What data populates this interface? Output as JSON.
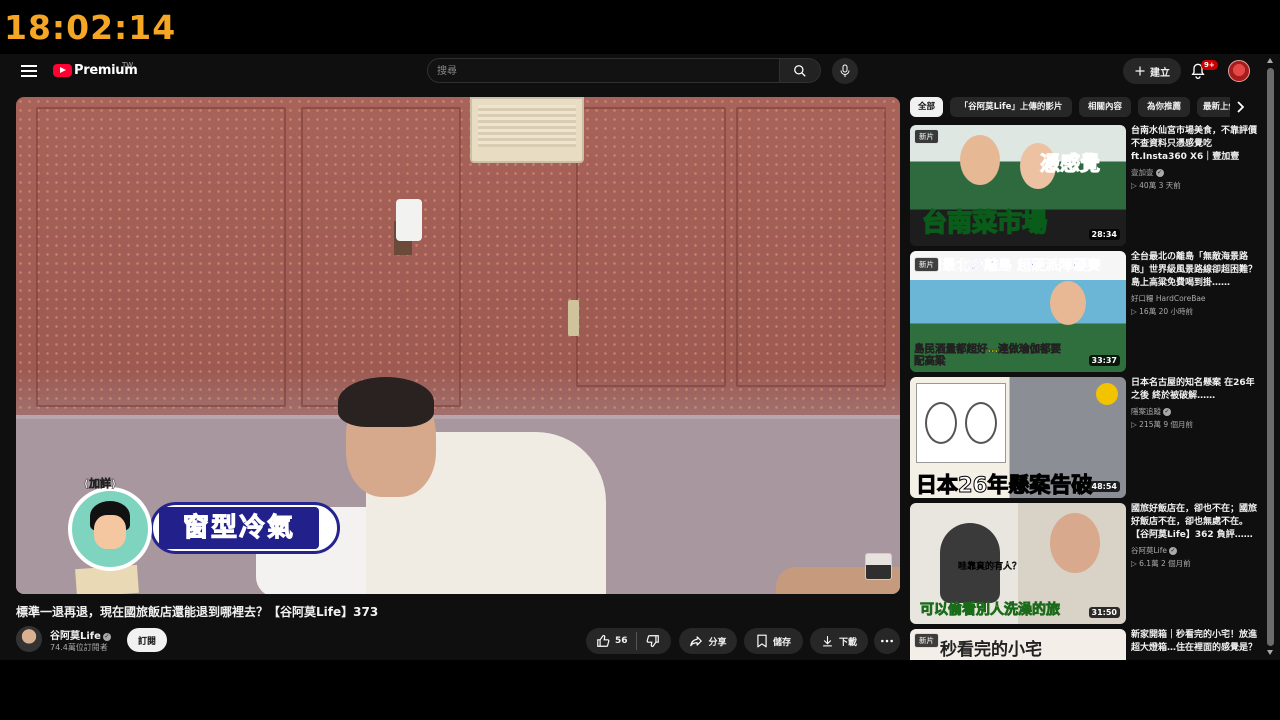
{
  "overlay": {
    "clock": "18:02:14"
  },
  "header": {
    "logo_text": "Premium",
    "region": "TW",
    "search_placeholder": "搜尋",
    "create_label": "建立",
    "notification_count": "9+"
  },
  "player": {
    "caption_tag": "(加詳)",
    "caption_text": "窗型冷氣"
  },
  "video": {
    "title": "標準一退再退，現在國旅飯店還能退到哪裡去？【谷阿莫Life】373",
    "channel_name": "谷阿莫Life",
    "subscribers": "74.4萬位訂閱者",
    "subscribe_label": "訂閱",
    "like_count": "56",
    "share_label": "分享",
    "save_label": "儲存",
    "download_label": "下載"
  },
  "sidebar": {
    "chips": [
      "全部",
      "「谷阿莫Life」上傳的影片",
      "相關內容",
      "為你推薦",
      "最新上傳"
    ],
    "recommendations": [
      {
        "title": "台南水仙宮市場美食，不靠評價不查資料只憑感覺吃 ft.Insta360 X6｜壹加壹",
        "channel": "壹加壹",
        "meta": "▷ 40萬  3 天前",
        "duration": "28:34",
        "new": "新片",
        "thumb_text": "台南菜市場",
        "thumb_text2": "憑感覺"
      },
      {
        "title": "全台最北の離島「無敵海景路跑」世界級風景路線卻超困難？島上高粱免費喝到掛……",
        "channel": "好口糧 HardCoreBae",
        "meta": "▷ 16萬  20 小時前",
        "duration": "33:37",
        "new": "新片",
        "thumb_text": "島民酒量都超好…連做瑜伽都要配高粱",
        "thumb_text2": "台灣最北の離島 超硬派障礙賽"
      },
      {
        "title": "日本名古屋的知名懸案 在26年之後 終於被破解……",
        "channel": "隱案追蹤",
        "meta": "▷ 215萬  9 個月前",
        "duration": "48:54",
        "new": "",
        "thumb_text": "日本26年懸案告破",
        "thumb_text2": ""
      },
      {
        "title": "國旅好飯店在，卻也不在；國旅好飯店不在，卻也無處不在。【谷阿莫Life】362 負評……",
        "channel": "谷阿莫Life",
        "meta": "▷ 6.1萬  2 個月前",
        "duration": "31:50",
        "new": "",
        "thumb_text": "可以偷看別人洗澡的旅",
        "thumb_text2": "哇靠真的有人？"
      },
      {
        "title": "新家開箱｜秒看完的小宅！放進超大燈箱…住在裡面的感覺是？",
        "channel": "",
        "meta": "",
        "duration": "",
        "new": "新片",
        "thumb_text": "秒看完的小宅",
        "thumb_text2": ""
      }
    ]
  },
  "colors": {
    "background": "#0f0f0f",
    "brand_red": "#ff0033",
    "clock": "#f5a623",
    "caption_blue": "#22208b"
  },
  "icons": [
    "menu-icon",
    "youtube-logo-icon",
    "search-icon",
    "mic-icon",
    "plus-icon",
    "bell-icon",
    "like-icon",
    "dislike-icon",
    "share-icon",
    "save-icon",
    "download-icon",
    "more-icon",
    "chevron-right-icon",
    "verified-icon"
  ]
}
